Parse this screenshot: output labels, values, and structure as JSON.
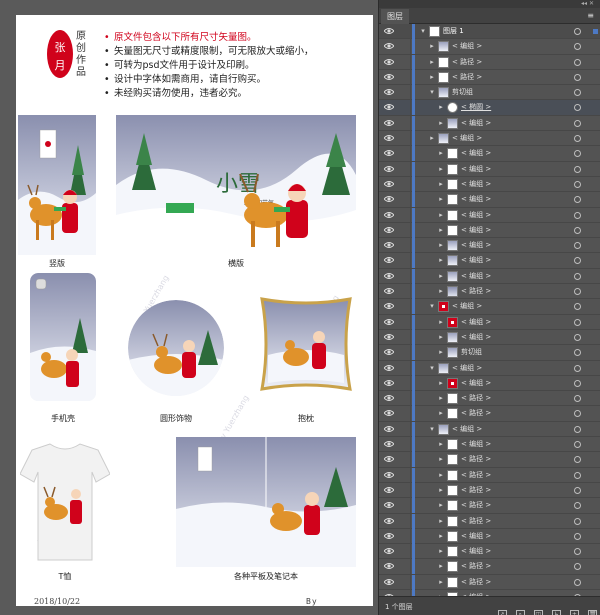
{
  "artboard": {
    "seal_char_1": "张",
    "seal_char_2": "月",
    "seal_text": "原创作品",
    "bullets": [
      "原文件包含以下所有尺寸矢量图。",
      "矢量图无尺寸或精度限制，可无限放大或缩小，",
      "可转为psd文件用于设计及印刷。",
      "设计中字体如需商用，请自行购买。",
      "未经购买请勿使用，违者必究。"
    ],
    "vertical_title": "二十四节气",
    "main_title": "小雪",
    "captions": {
      "vertical": "竖版",
      "horizontal": "横版",
      "phone": "手机壳",
      "round": "圆形饰物",
      "pillow": "抱枕",
      "tshirt": "T恤",
      "tablet": "各种平板及笔记本"
    },
    "watermark": "By Yuerzhang",
    "date": "2018/10/22",
    "by": "By  Yuerzhang"
  },
  "panel": {
    "tab_label": "图层",
    "layer_count": "1 个图层",
    "colors": {
      "selection": "#4d79c4",
      "panel_bg": "#535353"
    },
    "icons": [
      "eye-icon",
      "lock-column",
      "twirl-triangle-icon",
      "target-circle-icon",
      "selection-square-icon"
    ],
    "layers": [
      {
        "indent": 0,
        "expanded": true,
        "name": "图层 1",
        "thumb": "doc",
        "top": true
      },
      {
        "indent": 1,
        "expanded": false,
        "name": "< 编组 >",
        "thumb": "art"
      },
      {
        "indent": 1,
        "expanded": false,
        "name": "< 路径 >",
        "thumb": "blank"
      },
      {
        "indent": 1,
        "expanded": false,
        "name": "< 路径 >",
        "thumb": "blank"
      },
      {
        "indent": 1,
        "expanded": true,
        "name": "剪切组",
        "thumb": "art"
      },
      {
        "indent": 2,
        "expanded": false,
        "name": "< 椭圆 >",
        "thumb": "circle",
        "hl": true
      },
      {
        "indent": 2,
        "expanded": false,
        "name": "< 编组 >",
        "thumb": "art"
      },
      {
        "indent": 1,
        "expanded": false,
        "name": "< 编组 >",
        "thumb": "art"
      },
      {
        "indent": 2,
        "expanded": false,
        "name": "< 编组 >",
        "thumb": "blank"
      },
      {
        "indent": 2,
        "expanded": false,
        "name": "< 编组 >",
        "thumb": "blank"
      },
      {
        "indent": 2,
        "expanded": false,
        "name": "< 编组 >",
        "thumb": "blank"
      },
      {
        "indent": 2,
        "expanded": false,
        "name": "< 编组 >",
        "thumb": "blank"
      },
      {
        "indent": 2,
        "expanded": false,
        "name": "< 编组 >",
        "thumb": "blank"
      },
      {
        "indent": 2,
        "expanded": false,
        "name": "< 编组 >",
        "thumb": "blank"
      },
      {
        "indent": 2,
        "expanded": false,
        "name": "< 编组 >",
        "thumb": "art"
      },
      {
        "indent": 2,
        "expanded": false,
        "name": "< 编组 >",
        "thumb": "art"
      },
      {
        "indent": 2,
        "expanded": false,
        "name": "< 编组 >",
        "thumb": "art"
      },
      {
        "indent": 2,
        "expanded": false,
        "name": "< 路径 >",
        "thumb": "sky"
      },
      {
        "indent": 1,
        "expanded": true,
        "name": "< 编组 >",
        "thumb": "red"
      },
      {
        "indent": 2,
        "expanded": false,
        "name": "< 编组 >",
        "thumb": "red"
      },
      {
        "indent": 2,
        "expanded": false,
        "name": "< 编组 >",
        "thumb": "art"
      },
      {
        "indent": 2,
        "expanded": false,
        "name": "剪切组",
        "thumb": "art"
      },
      {
        "indent": 1,
        "expanded": true,
        "name": "< 编组 >",
        "thumb": "art"
      },
      {
        "indent": 2,
        "expanded": false,
        "name": "< 编组 >",
        "thumb": "red"
      },
      {
        "indent": 2,
        "expanded": false,
        "name": "< 路径 >",
        "thumb": "blank"
      },
      {
        "indent": 2,
        "expanded": false,
        "name": "< 路径 >",
        "thumb": "blank"
      },
      {
        "indent": 1,
        "expanded": true,
        "name": "< 编组 >",
        "thumb": "art"
      },
      {
        "indent": 2,
        "expanded": false,
        "name": "< 编组 >",
        "thumb": "blank"
      },
      {
        "indent": 2,
        "expanded": false,
        "name": "< 路径 >",
        "thumb": "blank"
      },
      {
        "indent": 2,
        "expanded": false,
        "name": "< 路径 >",
        "thumb": "blank"
      },
      {
        "indent": 2,
        "expanded": false,
        "name": "< 路径 >",
        "thumb": "blank"
      },
      {
        "indent": 2,
        "expanded": false,
        "name": "< 路径 >",
        "thumb": "blank"
      },
      {
        "indent": 2,
        "expanded": false,
        "name": "< 路径 >",
        "thumb": "blank"
      },
      {
        "indent": 2,
        "expanded": false,
        "name": "< 编组 >",
        "thumb": "blank"
      },
      {
        "indent": 2,
        "expanded": false,
        "name": "< 编组 >",
        "thumb": "blank"
      },
      {
        "indent": 2,
        "expanded": false,
        "name": "< 路径 >",
        "thumb": "blank"
      },
      {
        "indent": 2,
        "expanded": false,
        "name": "< 路径 >",
        "thumb": "blank"
      },
      {
        "indent": 2,
        "expanded": false,
        "name": "< 编组 >",
        "thumb": "blank"
      }
    ]
  }
}
